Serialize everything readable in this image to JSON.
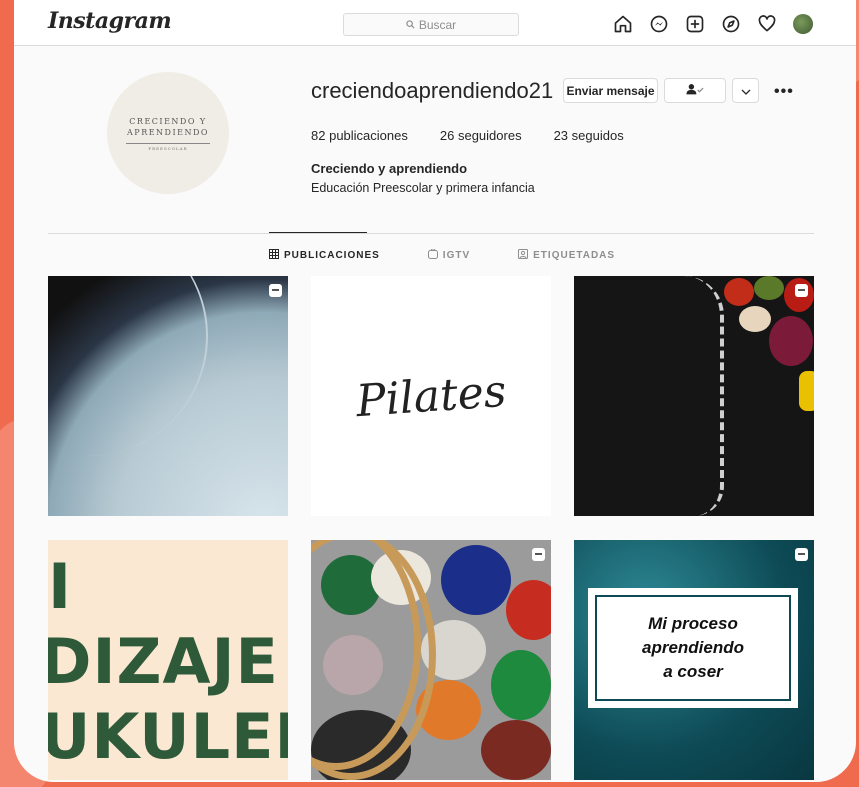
{
  "app": {
    "logo": "Instagram",
    "search_placeholder": "Buscar",
    "nav_icons": [
      "home-icon",
      "messenger-icon",
      "new-post-icon",
      "explore-icon",
      "activity-heart-icon",
      "profile-avatar"
    ]
  },
  "profile": {
    "avatar_text": {
      "line1": "CRECIENDO Y",
      "line2": "APRENDIENDO",
      "sub": "PREESCOLAR"
    },
    "username": "creciendoaprendiendo21",
    "buttons": {
      "message": "Enviar mensaje",
      "following_icon": "person-check-icon",
      "more_dropdown": "chevron-down-icon",
      "options": "•••"
    },
    "stats": [
      {
        "count": "82",
        "label": "publicaciones"
      },
      {
        "count": "26",
        "label": "seguidores"
      },
      {
        "count": "23",
        "label": "seguidos"
      }
    ],
    "display_name": "Creciendo y aprendiendo",
    "bio": "Educación Preescolar y primera infancia"
  },
  "tabs": [
    {
      "label": "PUBLICACIONES",
      "icon": "grid-icon",
      "active": true
    },
    {
      "label": "IGTV",
      "icon": "igtv-icon",
      "active": false
    },
    {
      "label": "ETIQUETADAS",
      "icon": "tagged-icon",
      "active": false
    }
  ],
  "posts": [
    {
      "type": "video",
      "text": ""
    },
    {
      "type": "image",
      "text": "Pilates"
    },
    {
      "type": "video",
      "text": ""
    },
    {
      "type": "image",
      "text_lines": [
        "I",
        "DIZAJE",
        "UKULELI"
      ]
    },
    {
      "type": "video",
      "text": ""
    },
    {
      "type": "video",
      "text_lines": [
        "Mi proceso",
        "aprendiendo",
        "a coser"
      ]
    }
  ],
  "colors": {
    "background_accent": "#f06a4e",
    "text_primary": "#262626",
    "text_secondary": "#8e8e8e",
    "border": "#dbdbdb"
  }
}
